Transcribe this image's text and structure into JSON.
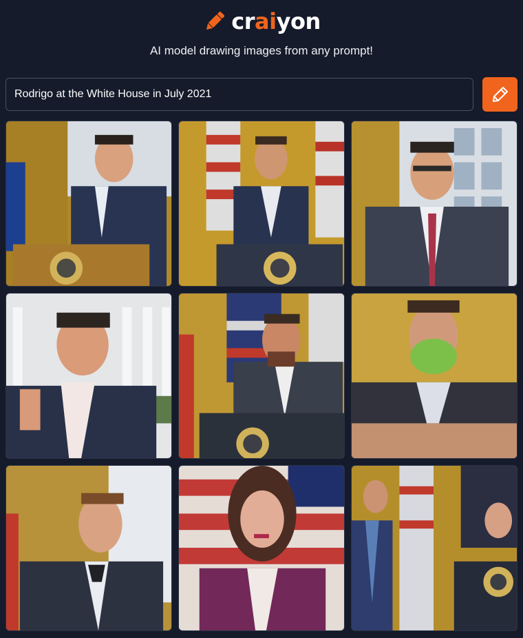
{
  "header": {
    "logo_prefix": "cr",
    "logo_accent": "ai",
    "logo_suffix": "yon",
    "tagline": "AI model drawing images from any prompt!"
  },
  "prompt": {
    "value": "Rodrigo at the White House in July 2021",
    "button_icon": "pencil-icon"
  },
  "colors": {
    "background": "#151b2a",
    "accent": "#f1641e",
    "input_border": "#4a5163"
  },
  "results": {
    "count": 9,
    "images": [
      {
        "icon": "generated-image",
        "scene": "podium-curtain"
      },
      {
        "icon": "generated-image",
        "scene": "podium-flags"
      },
      {
        "icon": "generated-image",
        "scene": "window-portrait"
      },
      {
        "icon": "generated-image",
        "scene": "white-house-exterior"
      },
      {
        "icon": "generated-image",
        "scene": "podium-flags"
      },
      {
        "icon": "generated-image",
        "scene": "masked-portrait"
      },
      {
        "icon": "generated-image",
        "scene": "window-portrait"
      },
      {
        "icon": "generated-image",
        "scene": "flag-portrait"
      },
      {
        "icon": "generated-image",
        "scene": "podium-curtain"
      }
    ]
  }
}
